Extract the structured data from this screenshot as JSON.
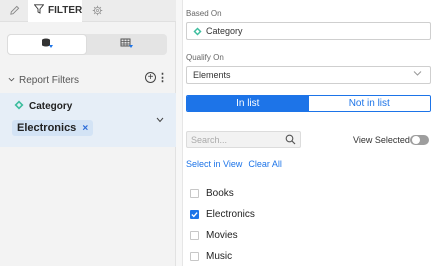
{
  "tabs": {
    "filter_label": "FILTER"
  },
  "report_filters": {
    "title": "Report Filters",
    "add_symbol": "+",
    "more_symbol": "⋮"
  },
  "filter_card": {
    "attribute": "Category",
    "selected_chip": "Electronics",
    "remove_symbol": "×"
  },
  "editor": {
    "based_on_label": "Based On",
    "based_on_value": "Category",
    "qualify_on_label": "Qualify On",
    "qualify_on_value": "Elements",
    "mode_in_list": "In list",
    "mode_not_in_list": "Not in list",
    "search_placeholder": "Search...",
    "view_selected_label": "View Selected",
    "view_selected_on": false,
    "select_in_view": "Select in View",
    "clear_all": "Clear All",
    "elements": [
      {
        "label": "Books",
        "checked": false
      },
      {
        "label": "Electronics",
        "checked": true
      },
      {
        "label": "Movies",
        "checked": false
      },
      {
        "label": "Music",
        "checked": false
      }
    ]
  },
  "colors": {
    "accent": "#1d74e8",
    "attribute_icon": "#3dbd9e"
  }
}
